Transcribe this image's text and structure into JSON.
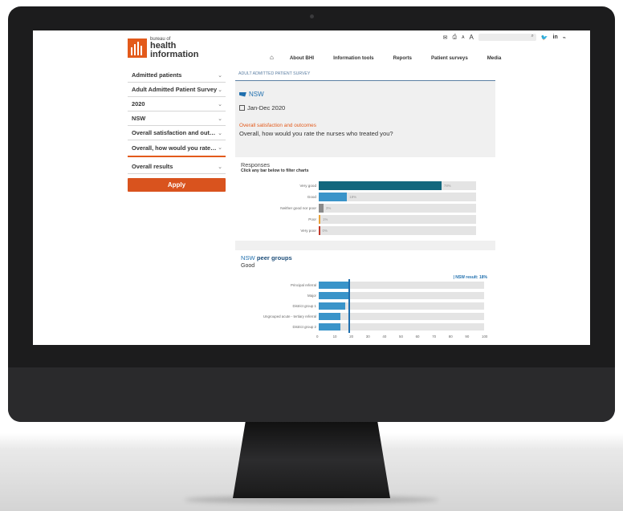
{
  "header": {
    "logo_small": "bureau of",
    "logo_line1": "health",
    "logo_line2": "information",
    "utility": {
      "font_small": "A",
      "font_large": "A",
      "search_placeholder": ""
    },
    "nav": [
      "About BHI",
      "Information tools",
      "Reports",
      "Patient surveys",
      "Media"
    ]
  },
  "sidebar": {
    "items": [
      "Admitted patients",
      "Adult Admitted Patient Survey",
      "2020",
      "NSW",
      "Overall satisfaction and out…",
      "Overall, how would you rate…",
      "Overall results"
    ],
    "apply_label": "Apply"
  },
  "main": {
    "breadcrumb": "ADULT ADMITTED PATIENT SURVEY",
    "region": "NSW",
    "period": "Jan-Dec 2020",
    "topic": "Overall satisfaction and outcomes",
    "question": "Overall, how would you rate the nurses who treated you?"
  },
  "responses": {
    "title": "Responses",
    "subtitle": "Click any bar below to filter charts",
    "rows": [
      {
        "label": "Very good",
        "value": 78,
        "value_label": "78%",
        "color": "#13677d"
      },
      {
        "label": "Good",
        "value": 18,
        "value_label": "18%",
        "color": "#3a94c9"
      },
      {
        "label": "Neither good nor poor",
        "value": 3,
        "value_label": "3%",
        "color": "#8a8a8a"
      },
      {
        "label": "Poor",
        "value": 1,
        "value_label": "1%",
        "color": "#e8a23a"
      },
      {
        "label": "Very poor",
        "value": 0,
        "value_label": "0%",
        "color": "#c0392b"
      }
    ]
  },
  "peer_groups": {
    "title_region": "NSW",
    "title_rest": "peer groups",
    "category": "Good",
    "nsw_result_label": "| NSW result: 18%",
    "nsw_result": 18
  },
  "chart_data": {
    "type": "bar",
    "title": "NSW peer groups",
    "categories": [
      "Principal referral",
      "Major",
      "District group 1",
      "Ungrouped acute - tertiary referral",
      "District group 2"
    ],
    "values": [
      18,
      18,
      16,
      13,
      13
    ],
    "xlim": [
      0,
      100
    ],
    "xticks": [
      0,
      10,
      20,
      30,
      40,
      50,
      60,
      70,
      80,
      90,
      100
    ],
    "reference_line": 18
  }
}
